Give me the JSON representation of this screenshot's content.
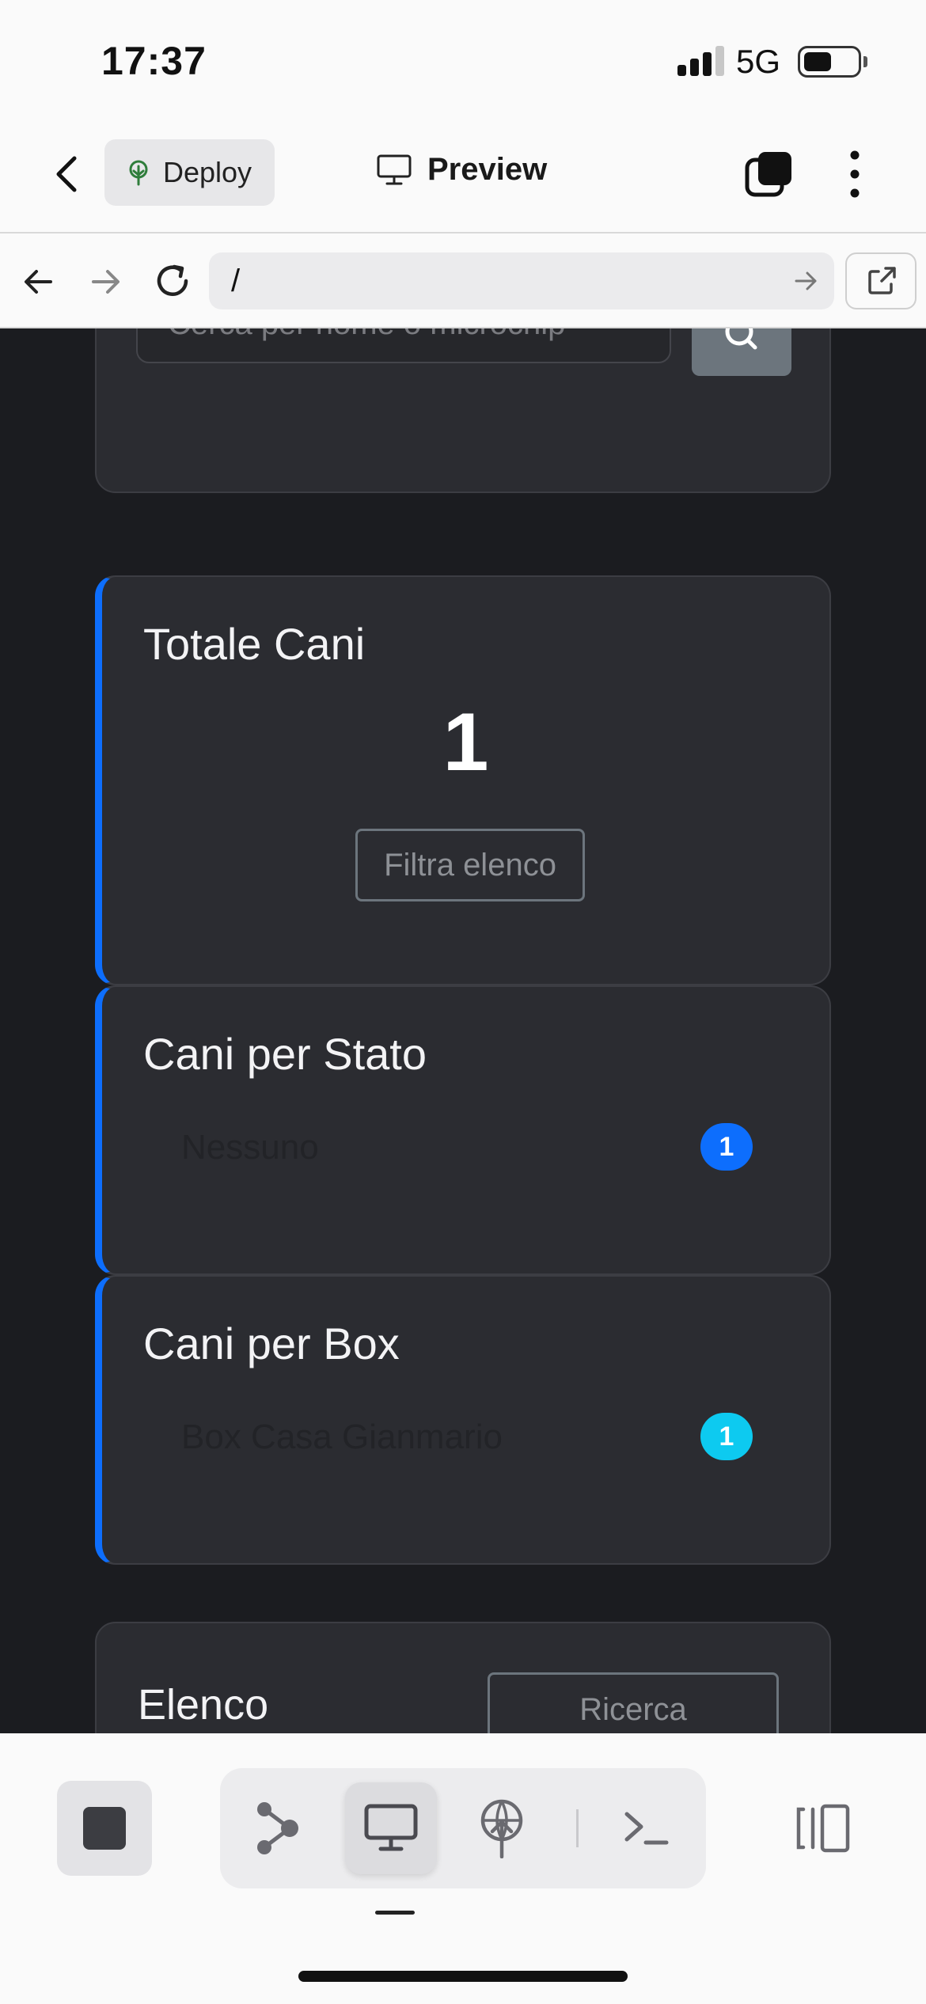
{
  "status_bar": {
    "time": "17:37",
    "network": "5G"
  },
  "toolbar": {
    "deploy_label": "Deploy",
    "preview_label": "Preview"
  },
  "browser": {
    "url": "/"
  },
  "search": {
    "placeholder": "Cerca per nome o microchip"
  },
  "stats": {
    "total_title": "Totale Cani",
    "total_value": "1",
    "filter_label": "Filtra elenco",
    "by_state_title": "Cani per Stato",
    "by_state_rows": [
      {
        "label": "Nessuno",
        "count": "1",
        "badge_color": "#0d6efd"
      }
    ],
    "by_box_title": "Cani per Box",
    "by_box_rows": [
      {
        "label": "Box Casa Gianmario",
        "count": "1",
        "badge_color": "#0dcaf0"
      }
    ]
  },
  "list": {
    "title": "Elenco",
    "search_button": "Ricerca"
  },
  "colors": {
    "accent": "#0d6efd",
    "info": "#0dcaf0",
    "page_bg": "#1b1c20",
    "card_bg": "#2b2c31"
  },
  "icons": [
    "back-chevron-icon",
    "deploy-tree-icon",
    "monitor-icon",
    "tabs-icon",
    "more-vertical-icon",
    "arrow-left-icon",
    "arrow-right-icon",
    "reload-icon",
    "open-external-icon",
    "search-icon",
    "stop-icon",
    "graph-icon",
    "antenna-icon",
    "terminal-icon",
    "split-view-icon"
  ]
}
